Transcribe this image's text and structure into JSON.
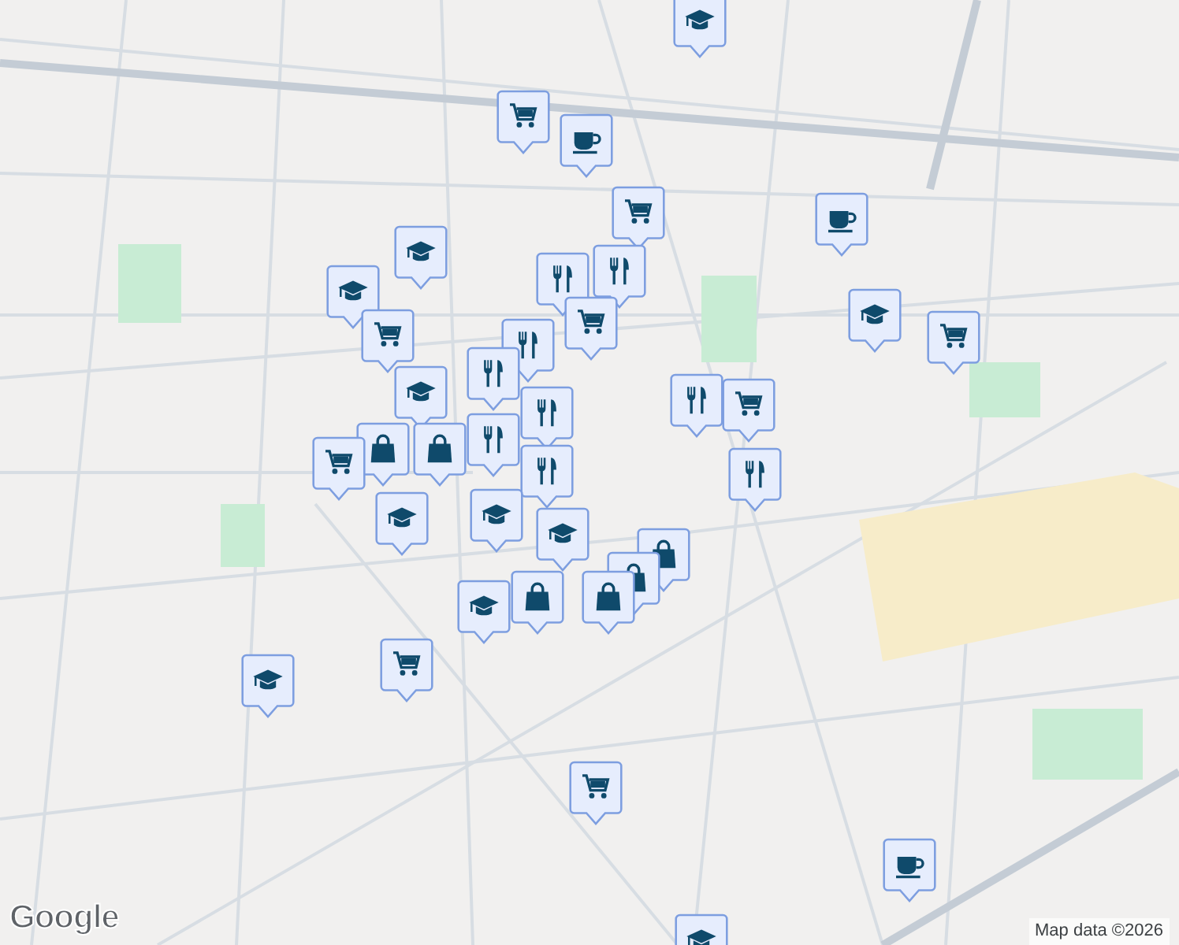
{
  "map": {
    "markers": [
      {
        "kind": "school"
      },
      {
        "kind": "cart"
      },
      {
        "kind": "cup"
      },
      {
        "kind": "cart"
      },
      {
        "kind": "cup"
      },
      {
        "kind": "school"
      },
      {
        "kind": "school"
      },
      {
        "kind": "cart"
      },
      {
        "kind": "fork"
      },
      {
        "kind": "fork"
      },
      {
        "kind": "cart"
      },
      {
        "kind": "school"
      },
      {
        "kind": "cart"
      },
      {
        "kind": "fork"
      },
      {
        "kind": "fork"
      },
      {
        "kind": "fork"
      },
      {
        "kind": "school"
      },
      {
        "kind": "bag"
      },
      {
        "kind": "bag"
      },
      {
        "kind": "fork"
      },
      {
        "kind": "fork"
      },
      {
        "kind": "fork"
      },
      {
        "kind": "cart"
      },
      {
        "kind": "fork"
      },
      {
        "kind": "cart"
      },
      {
        "kind": "school"
      },
      {
        "kind": "school"
      },
      {
        "kind": "school"
      },
      {
        "kind": "bag"
      },
      {
        "kind": "bag"
      },
      {
        "kind": "bag"
      },
      {
        "kind": "school"
      },
      {
        "kind": "bag"
      },
      {
        "kind": "school"
      },
      {
        "kind": "cart"
      },
      {
        "kind": "cart"
      },
      {
        "kind": "cup"
      },
      {
        "kind": "school"
      }
    ]
  },
  "attribution": {
    "logo": "Google",
    "text": "Map data ©2026"
  }
}
